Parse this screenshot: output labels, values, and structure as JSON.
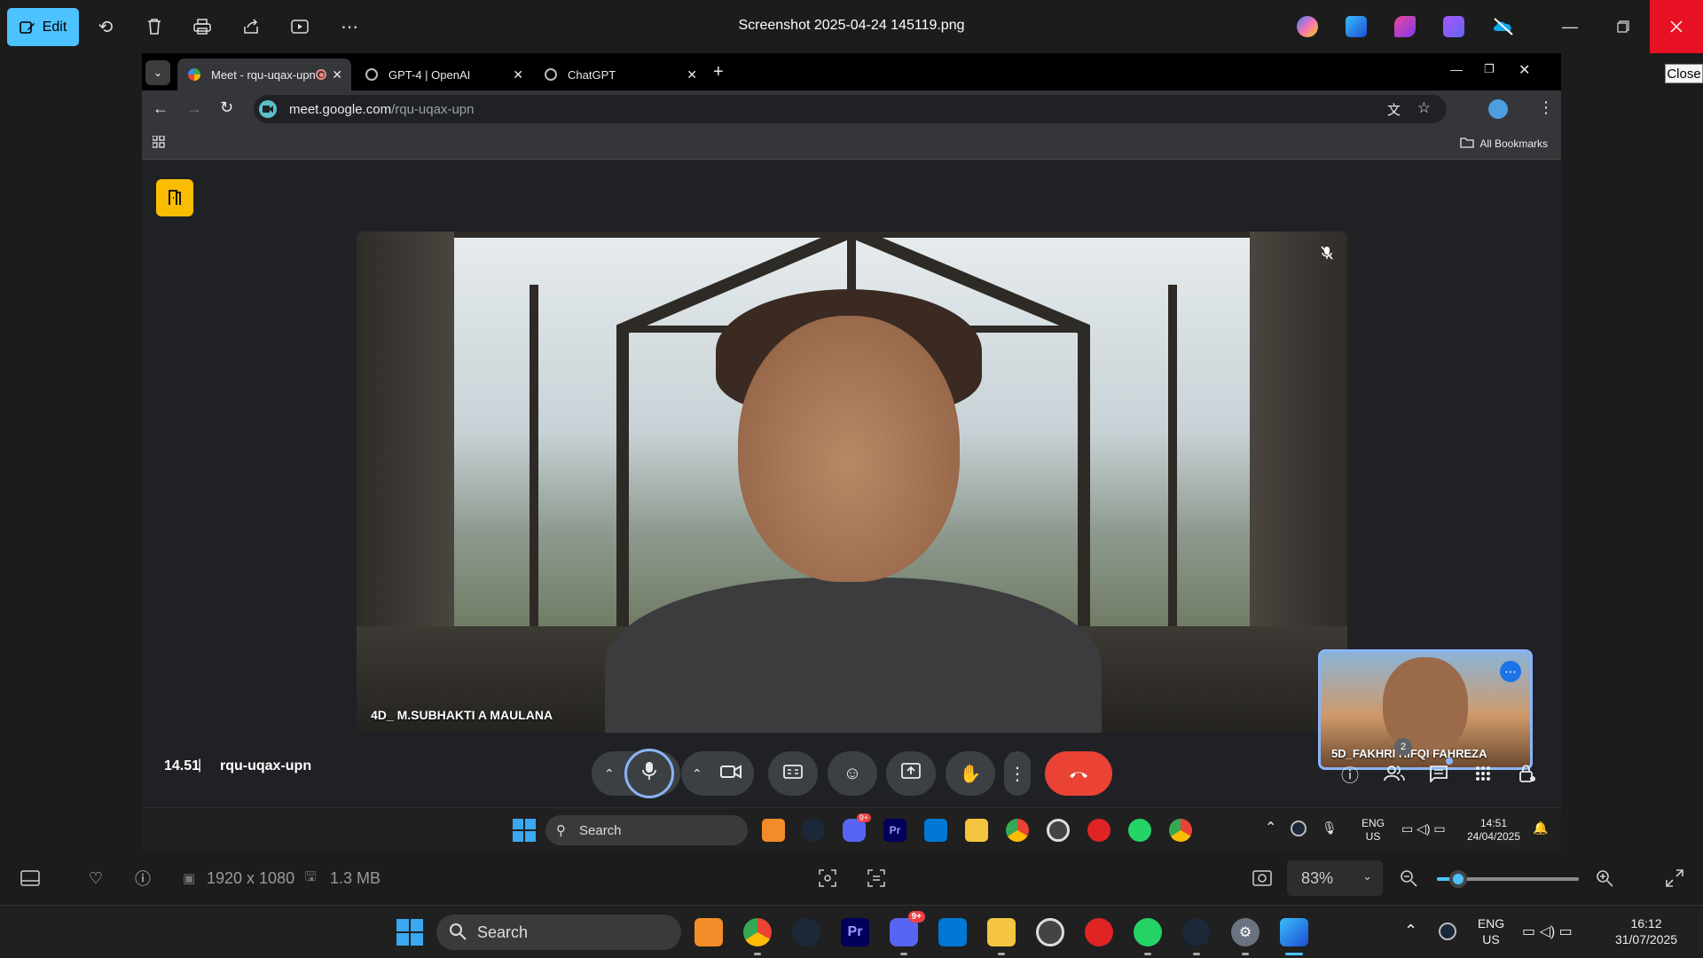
{
  "photos": {
    "edit_label": "Edit",
    "file_title": "Screenshot 2025-04-24 145119.png",
    "close_tooltip": "Close",
    "dimensions": "1920 x 1080",
    "file_size": "1.3 MB",
    "zoom": "83%",
    "zoom_level": 0.15
  },
  "browser": {
    "tabs": [
      {
        "label": "Meet - rqu-uqax-upn",
        "favicon": "google-meet-icon",
        "recording": true,
        "active": true
      },
      {
        "label": "GPT-4 | OpenAI",
        "favicon": "openai-icon",
        "active": false
      },
      {
        "label": "ChatGPT",
        "favicon": "chatgpt-icon",
        "active": false
      }
    ],
    "url_host": "meet.google.com",
    "url_path": "/rqu-uqax-upn",
    "bookmarks_label": "All Bookmarks"
  },
  "meet": {
    "main_participant": "4D_ M.SUBHAKTI A MAULANA",
    "self_participant": "5D_FAKHRI RIFQI FAHREZA",
    "time": "14.51",
    "separator": "|",
    "meeting_code": "rqu-uqax-upn",
    "people_count": "2",
    "colors": {
      "end_call": "#ea4335",
      "accent": "#8ab4f8",
      "badge": "#fbbc04"
    }
  },
  "inner_taskbar": {
    "search_placeholder": "Search",
    "lang_top": "ENG",
    "lang_bottom": "US",
    "time": "14:51",
    "date": "24/04/2025",
    "discord_badge": "9+"
  },
  "taskbar": {
    "search_placeholder": "Search",
    "lang_top": "ENG",
    "lang_bottom": "US",
    "time": "16:12",
    "date": "31/07/2025",
    "discord_badge": "9+",
    "premiere_label": "Pr"
  }
}
